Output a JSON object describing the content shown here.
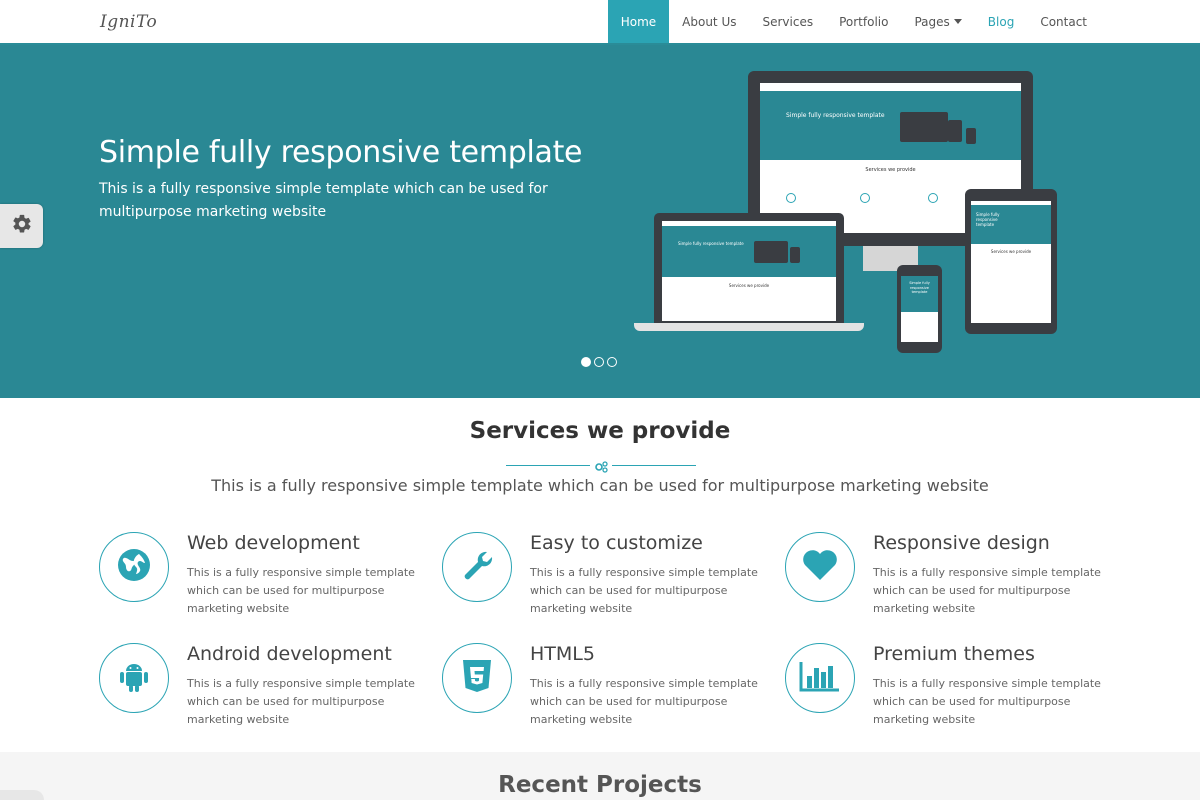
{
  "brand": {
    "logo": "IgniTo"
  },
  "nav": {
    "items": [
      {
        "label": "Home",
        "active": true
      },
      {
        "label": "About Us"
      },
      {
        "label": "Services"
      },
      {
        "label": "Portfolio"
      },
      {
        "label": "Pages",
        "dropdown": true
      },
      {
        "label": "Blog"
      },
      {
        "label": "Contact"
      }
    ]
  },
  "hero": {
    "title": "Simple fully responsive template",
    "subtitle": "This is a fully responsive simple template which can be used for multipurpose marketing website",
    "slides": 3,
    "active_slide": 1
  },
  "services": {
    "title": "Services we provide",
    "subtitle": "This is a fully responsive simple template which can be used for multipurpose marketing website",
    "items": [
      {
        "title": "Web development",
        "text": "This is a fully responsive simple template which can be used for multipurpose marketing website",
        "icon": "globe-icon"
      },
      {
        "title": "Easy to customize",
        "text": "This is a fully responsive simple template which can be used for multipurpose marketing website",
        "icon": "wrench-icon"
      },
      {
        "title": "Responsive design",
        "text": "This is a fully responsive simple template which can be used for multipurpose marketing website",
        "icon": "heart-icon"
      },
      {
        "title": "Android development",
        "text": "This is a fully responsive simple template which can be used for multipurpose marketing website",
        "icon": "android-icon"
      },
      {
        "title": "HTML5",
        "text": "This is a fully responsive simple template which can be used for multipurpose marketing website",
        "icon": "html5-icon"
      },
      {
        "title": "Premium themes",
        "text": "This is a fully responsive simple template which can be used for multipurpose marketing website",
        "icon": "bar-chart-icon"
      }
    ]
  },
  "recent": {
    "title": "Recent Projects"
  },
  "mockups": {
    "monitor_hero_text": "Simple fully responsive template",
    "monitor_section_text": "Services we provide",
    "laptop_hero_text": "Simple fully responsive template",
    "laptop_section_text": "Services we provide",
    "tablet_hero_text": "Simple fully responsive template",
    "tablet_section_text": "Services we provide",
    "phone_hero_text": "Simple fully responsive template"
  },
  "colors": {
    "accent": "#2ba4b4",
    "hero_bg": "#2a8894",
    "device_frame": "#3a3d42"
  }
}
